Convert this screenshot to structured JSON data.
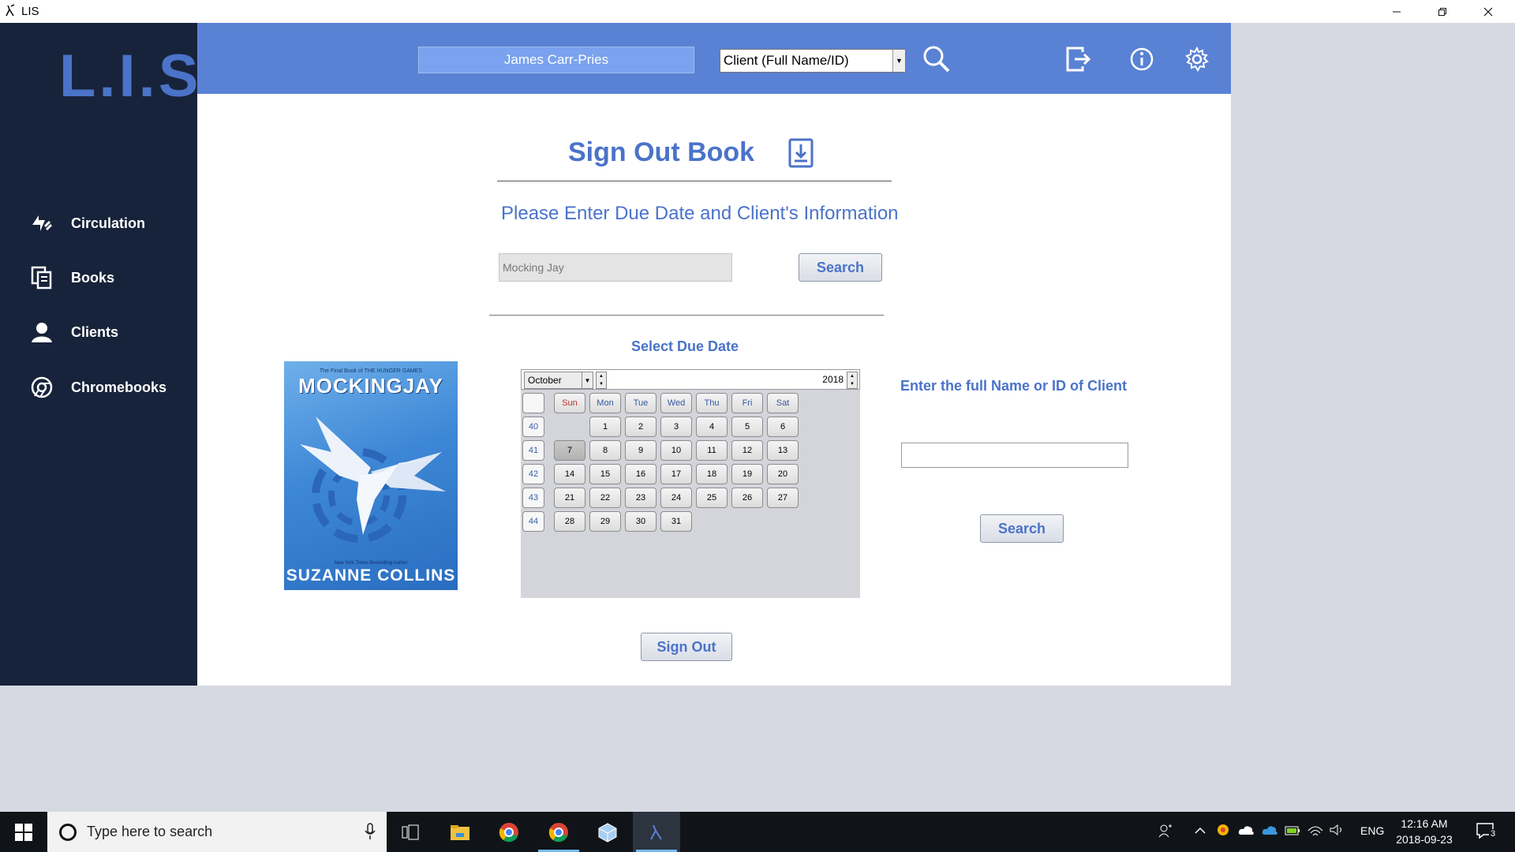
{
  "window": {
    "title": "LIS"
  },
  "app": {
    "logo": "L.I.S.",
    "header": {
      "user_name": "James Carr-Pries",
      "search_mode": "Client (Full Name/ID)"
    },
    "sidebar": {
      "items": [
        {
          "label": "Circulation",
          "icon": "circulation-icon"
        },
        {
          "label": "Books",
          "icon": "books-icon"
        },
        {
          "label": "Clients",
          "icon": "clients-icon"
        },
        {
          "label": "Chromebooks",
          "icon": "chromebook-icon"
        }
      ]
    },
    "main": {
      "title": "Sign Out Book",
      "subtitle": "Please Enter Due Date and Client's Information",
      "book_search_value": "Mocking Jay",
      "book_search_button": "Search",
      "due_date_label": "Select Due Date",
      "client_label": "Enter the full Name or ID of Client",
      "client_input_value": "",
      "client_search_button": "Search",
      "sign_out_button": "Sign Out",
      "book_cover": {
        "top_line": "The Final Book of THE HUNGER GAMES",
        "title": "MOCKINGJAY",
        "tagline": "New York Times Bestselling Author",
        "author": "SUZANNE COLLINS"
      }
    },
    "calendar": {
      "month": "October",
      "year": "2018",
      "days_of_week": [
        "Sun",
        "Mon",
        "Tue",
        "Wed",
        "Thu",
        "Fri",
        "Sat"
      ],
      "weeks": [
        {
          "week": "40",
          "days": [
            "",
            "1",
            "2",
            "3",
            "4",
            "5",
            "6"
          ]
        },
        {
          "week": "41",
          "days": [
            "7",
            "8",
            "9",
            "10",
            "11",
            "12",
            "13"
          ]
        },
        {
          "week": "42",
          "days": [
            "14",
            "15",
            "16",
            "17",
            "18",
            "19",
            "20"
          ]
        },
        {
          "week": "43",
          "days": [
            "21",
            "22",
            "23",
            "24",
            "25",
            "26",
            "27"
          ]
        },
        {
          "week": "44",
          "days": [
            "28",
            "29",
            "30",
            "31",
            "",
            "",
            ""
          ]
        }
      ],
      "selected_day": "7"
    }
  },
  "taskbar": {
    "search_placeholder": "Type here to search",
    "language": "ENG",
    "time": "12:16 AM",
    "date": "2018-09-23",
    "notification_count": "3"
  },
  "colors": {
    "accent": "#4a73c9",
    "sidebar": "#17233a",
    "topbar": "#5a82d4"
  }
}
